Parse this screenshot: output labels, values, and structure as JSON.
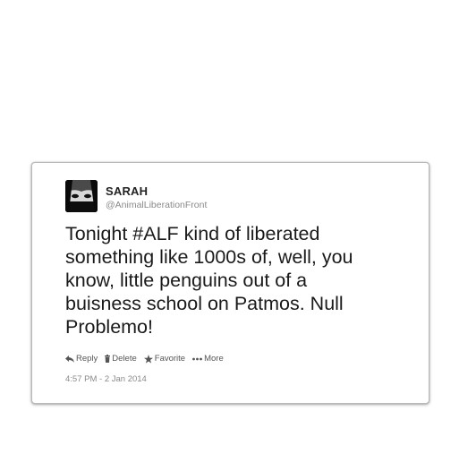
{
  "tweet": {
    "user_name": "SARAH",
    "user_handle": "@AnimalLiberationFront",
    "text": "Tonight #ALF kind of liberated\nsomething like 1000s of, well, you\nknow, little penguins out of a\nbuisness school on Patmos. Null\nProblemo!",
    "timestamp": "4:57 PM - 2 Jan 2014"
  },
  "actions": {
    "reply": {
      "label": "Reply",
      "icon": "reply-arrow-icon"
    },
    "delete": {
      "label": "Delete",
      "icon": "trash-icon"
    },
    "favorite": {
      "label": "Favorite",
      "icon": "star-icon"
    },
    "more": {
      "label": "More",
      "icon": "ellipsis-icon"
    }
  },
  "colors": {
    "text": "#1a1a1a",
    "muted": "#8a8a8a",
    "border": "#b9b9b9"
  }
}
